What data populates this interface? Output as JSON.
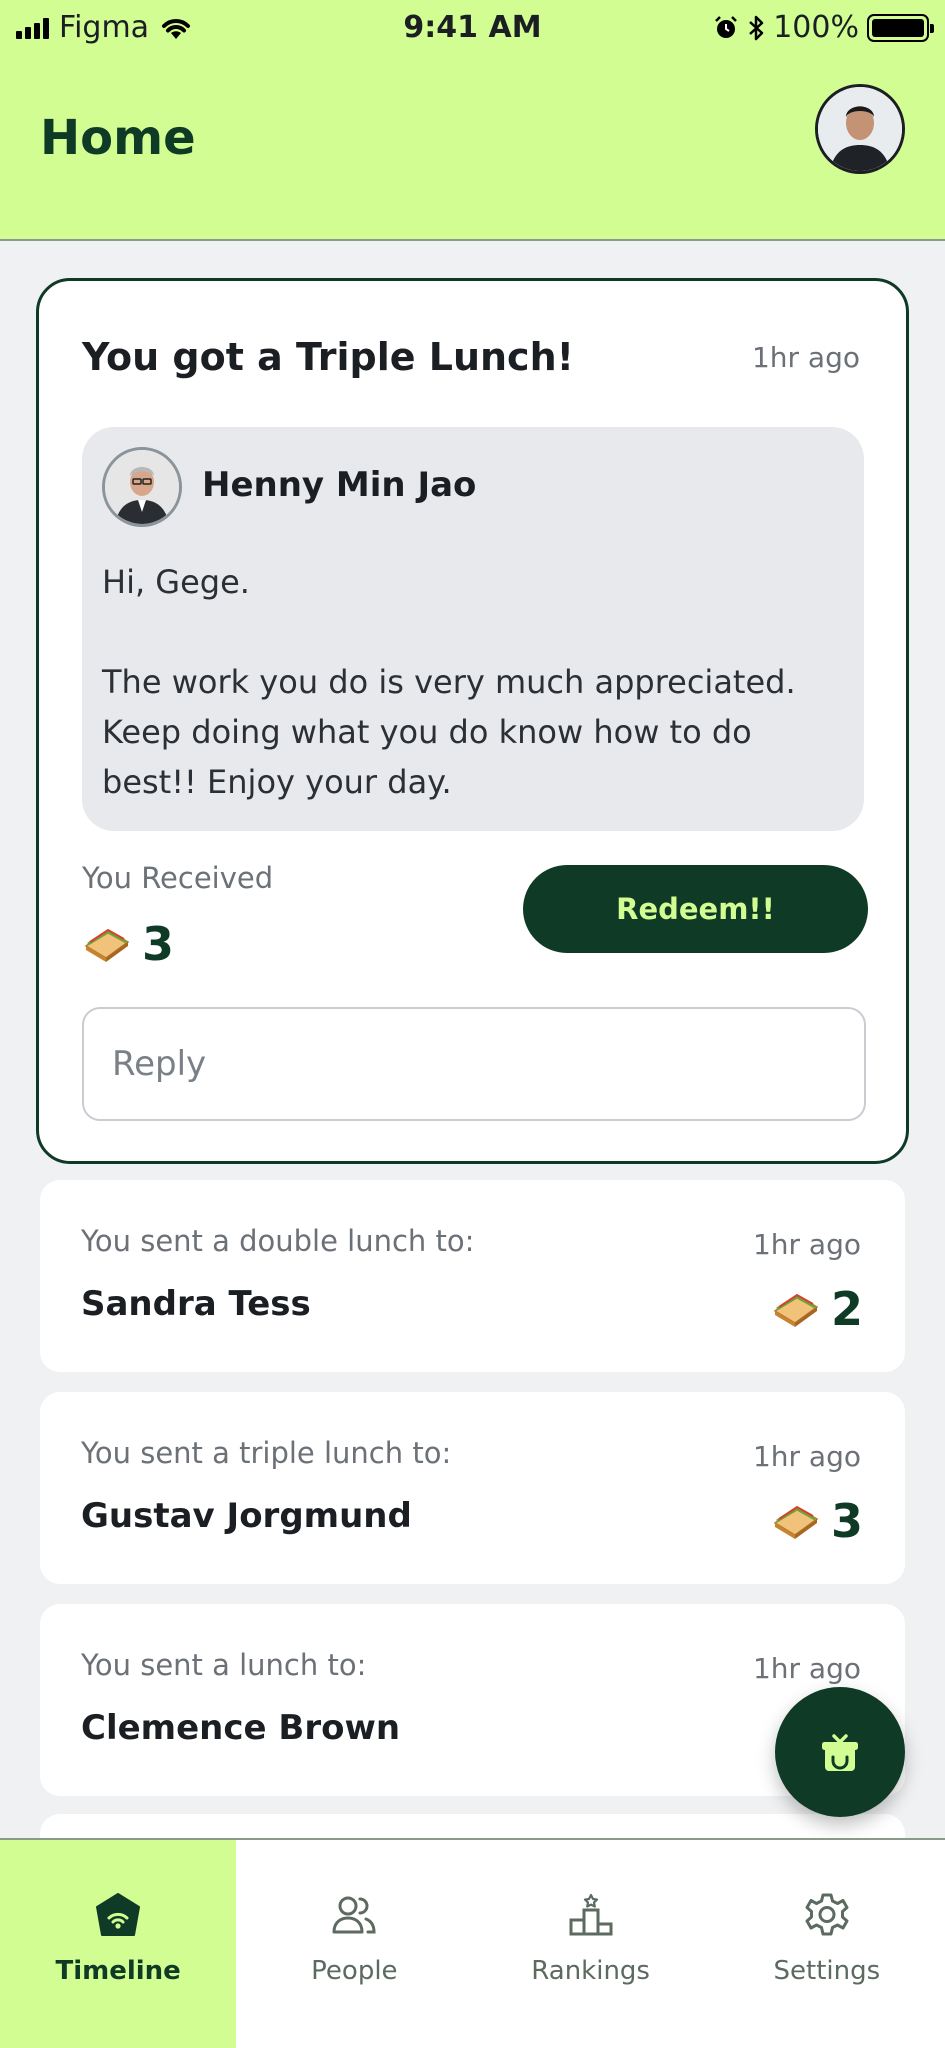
{
  "status_bar": {
    "carrier": "Figma",
    "time": "9:41 AM",
    "battery": "100%"
  },
  "header": {
    "title": "Home"
  },
  "featured": {
    "title": "You got a Triple Lunch!",
    "time": "1hr ago",
    "sender": "Henny Min Jao",
    "message_lines": [
      "Hi, Gege.",
      "The work you do is very much appreciated. Keep doing what you do know how to do best!! Enjoy your day."
    ],
    "received_label": "You Received",
    "received_count": "3",
    "redeem_label": "Redeem!!",
    "reply_placeholder": "Reply"
  },
  "activity": [
    {
      "label": "You sent a double lunch to:",
      "name": "Sandra Tess",
      "time": "1hr ago",
      "count": "2"
    },
    {
      "label": "You sent a triple lunch to:",
      "name": "Gustav Jorgmund",
      "time": "1hr ago",
      "count": "3"
    },
    {
      "label": "You sent a lunch to:",
      "name": "Clemence Brown",
      "time": "1hr ago"
    }
  ],
  "tabs": [
    {
      "label": "Timeline",
      "icon": "timeline-icon",
      "active": true
    },
    {
      "label": "People",
      "icon": "people-icon"
    },
    {
      "label": "Rankings",
      "icon": "rankings-icon"
    },
    {
      "label": "Settings",
      "icon": "settings-icon"
    }
  ],
  "colors": {
    "accent": "#d2fd92",
    "dark_green": "#0f3a26",
    "background": "#f0f1f3"
  }
}
